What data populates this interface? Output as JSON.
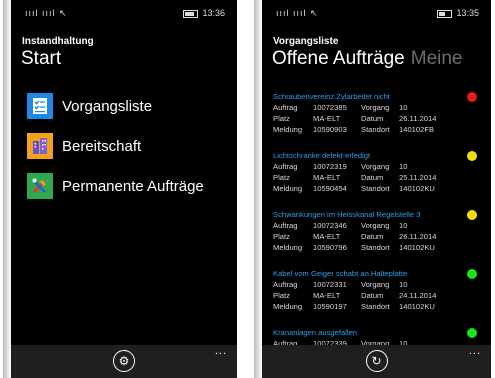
{
  "left_screen": {
    "status": {
      "signal": "ıııl ıııl ↖",
      "time": "13:36"
    },
    "app_title": "Instandhaltung",
    "page_title": "Start",
    "menu": [
      {
        "label": "Vorgangsliste",
        "icon": "checklist-icon",
        "tile_color": "#1e88e5"
      },
      {
        "label": "Bereitschaft",
        "icon": "building-icon",
        "tile_color": "#f3a21a"
      },
      {
        "label": "Permanente Aufträge",
        "icon": "tools-icon",
        "tile_color": "#2fa84f"
      }
    ],
    "appbar": {
      "settings_icon": "⚙",
      "more": "..."
    }
  },
  "right_screen": {
    "status": {
      "signal": "ıııl ıııl ↖",
      "time": "13:35"
    },
    "app_title": "Vorgangsliste",
    "pivot_active": "Offene Aufträge",
    "pivot_next": "Meine",
    "field_labels": {
      "auftrag": "Auftrag",
      "vorgang": "Vorgang",
      "platz": "Platz",
      "datum": "Datum",
      "meldung": "Meldung",
      "standort": "Standort"
    },
    "orders": [
      {
        "title": "Schraubenvereinz.Zylarbeitet nicht",
        "auftrag": "10072385",
        "vorgang": "10",
        "platz": "MA-ELT",
        "datum": "26.11.2014",
        "meldung": "10590903",
        "standort": "140102FB",
        "status_color": "#ee1c1c"
      },
      {
        "title": "Lichtschranke defekt-erledigt",
        "auftrag": "10072319",
        "vorgang": "10",
        "platz": "MA-ELT",
        "datum": "25.11.2014",
        "meldung": "10590454",
        "standort": "140102KU",
        "status_color": "#f2e000"
      },
      {
        "title": "Schwankungen im Heisskanal Regelstelle 3",
        "auftrag": "10072346",
        "vorgang": "10",
        "platz": "MA-ELT",
        "datum": "26.11.2014",
        "meldung": "10590796",
        "standort": "140102KU",
        "status_color": "#f2e000"
      },
      {
        "title": "Kabel vom Geiger schabt an Halteplatte",
        "auftrag": "10072331",
        "vorgang": "10",
        "platz": "MA-ELT",
        "datum": "24.11.2014",
        "meldung": "10590197",
        "standort": "140102KU",
        "status_color": "#1ce31c"
      },
      {
        "title": "Krananlagen ausgefallen",
        "auftrag": "10072339",
        "vorgang": "10",
        "status_color": "#1ce31c"
      }
    ],
    "appbar": {
      "refresh_icon": "↻",
      "more": "..."
    }
  }
}
